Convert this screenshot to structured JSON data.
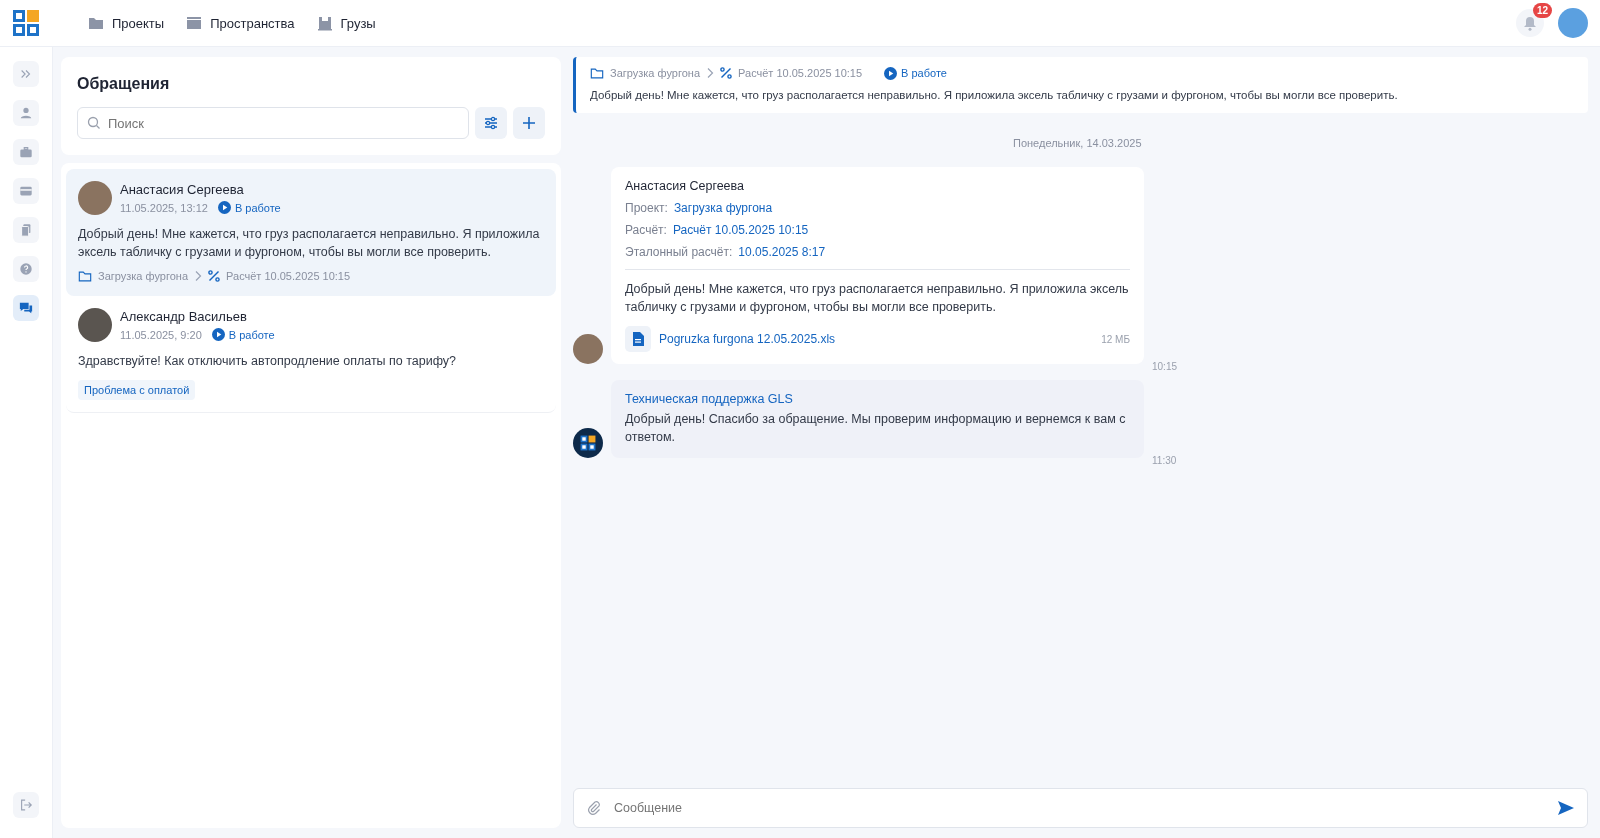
{
  "nav": {
    "items": [
      {
        "label": "Проекты",
        "kind": "folder"
      },
      {
        "label": "Пространства",
        "kind": "stack"
      },
      {
        "label": "Грузы",
        "kind": "box"
      }
    ],
    "notifications": "12"
  },
  "sidebar": {
    "items": [
      {
        "kind": "expand",
        "selected": false
      },
      {
        "kind": "user",
        "selected": false
      },
      {
        "kind": "briefcase",
        "selected": false
      },
      {
        "kind": "card",
        "selected": false
      },
      {
        "kind": "documents",
        "selected": false
      },
      {
        "kind": "help",
        "selected": false
      },
      {
        "kind": "chat",
        "selected": true
      }
    ],
    "bottom": {
      "kind": "logout",
      "selected": false
    }
  },
  "tickets": {
    "title": "Обращения",
    "search": {
      "placeholder": "Поиск"
    },
    "items": [
      {
        "name": "Анастасия Сергеева",
        "datetime": "11.05.2025, 13:12",
        "status": "В работе",
        "text": "Добрый день! Мне кажется, что груз располагается неправильно. Я приложила эксель табличку с грузами и фургоном, чтобы вы могли все проверить.",
        "project": "Загрузка фургона",
        "calculation": "Расчёт 10.05.2025 10:15",
        "selected": true
      },
      {
        "name": "Александр Васильев",
        "datetime": "11.05.2025, 9:20",
        "status": "В работе",
        "text": "Здравствуйте! Как отключить автопродление оплаты по тарифу?",
        "tag": "Проблема с оплатой",
        "selected": false
      }
    ]
  },
  "chat": {
    "pinned": {
      "project": "Загрузка фургона",
      "calculation": "Расчёт 10.05.2025 10:15",
      "status": "В работе",
      "text": "Добрый день! Мне кажется, что груз располагается неправильно. Я приложила эксель табличку с грузами и фургоном, чтобы вы могли все проверить."
    },
    "date": "Понедельник, 14.03.2025",
    "messages": [
      {
        "kind": "user",
        "author": "Анастасия Сергеева",
        "fields": [
          {
            "label": "Проект:",
            "value": "Загрузка фургона"
          },
          {
            "label": "Расчёт:",
            "value": "Расчёт 10.05.2025 10:15"
          },
          {
            "label": "Эталонный расчёт:",
            "value": "10.05.2025 8:17"
          }
        ],
        "text": "Добрый день! Мне кажется, что груз располагается неправильно. Я приложила эксель табличку с грузами и фургоном, чтобы вы могли все проверить.",
        "attachment": {
          "name": "Pogruzka furgona 12.05.2025.xls",
          "size": "12 МБ"
        },
        "time": "10:15"
      },
      {
        "kind": "support",
        "author": "Техническая поддержка GLS",
        "text": "Добрый день! Спасибо за обращение. Мы проверим информацию и вернемся к вам с ответом.",
        "time": "11:30"
      }
    ],
    "composer": {
      "placeholder": "Сообщение"
    }
  }
}
